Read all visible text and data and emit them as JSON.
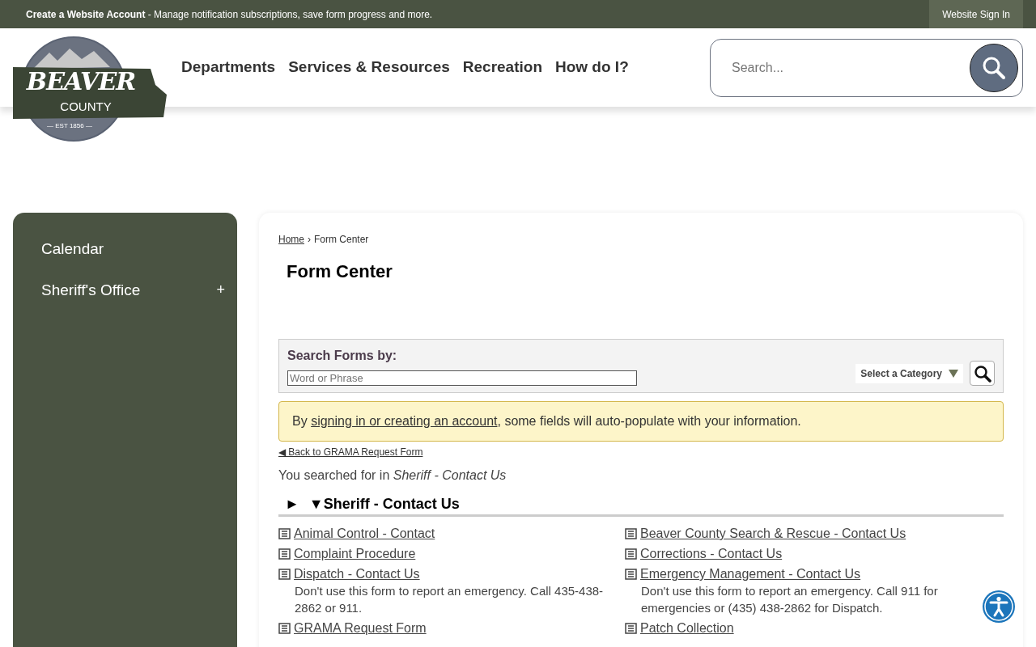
{
  "top_bar": {
    "account_link": "Create a Website Account",
    "account_text": " - Manage notification subscriptions, save form progress and more.",
    "sign_in": "Website Sign In"
  },
  "logo": {
    "name": "BEAVER",
    "subtitle": "COUNTY",
    "established": "— EST 1856 —"
  },
  "nav": [
    "Departments",
    "Services & Resources",
    "Recreation",
    "How do I?"
  ],
  "search": {
    "placeholder": "Search..."
  },
  "sidebar": {
    "items": [
      {
        "label": "Calendar"
      },
      {
        "label": "Sheriff's Office",
        "toggle": "+"
      }
    ]
  },
  "breadcrumb": [
    {
      "label": "Home",
      "link": true
    },
    {
      "label": "Form Center",
      "link": false
    }
  ],
  "separator": "›",
  "page_title": "Form Center",
  "search_forms": {
    "label": "Search Forms by:",
    "placeholder": "Word or Phrase",
    "category": "Select a Category"
  },
  "notice": {
    "before": "By ",
    "link": "signing in or creating an account",
    "after": ", some fields will auto-populate with your information."
  },
  "back_link": "◀ Back to GRAMA Request Form",
  "searched": {
    "text": "You searched for in ",
    "term": "Sheriff - Contact Us"
  },
  "section": {
    "markers": [
      "►",
      "▼"
    ],
    "title": "Sheriff - Contact Us"
  },
  "forms": [
    {
      "title": "Animal Control - Contact"
    },
    {
      "title": "Beaver County Search & Rescue - Contact Us"
    },
    {
      "title": "Complaint Procedure"
    },
    {
      "title": "Corrections - Contact Us"
    },
    {
      "title": "Dispatch - Contact Us",
      "description": "Don't use this form to report an emergency. Call 435-438-2862 or 911."
    },
    {
      "title": "Emergency Management - Contact Us",
      "description": "Don't use this form to report an emergency. Call 911 for emergencies or (435) 438-2862 for Dispatch."
    },
    {
      "title": "GRAMA Request Form"
    },
    {
      "title": "Patch Collection"
    }
  ]
}
